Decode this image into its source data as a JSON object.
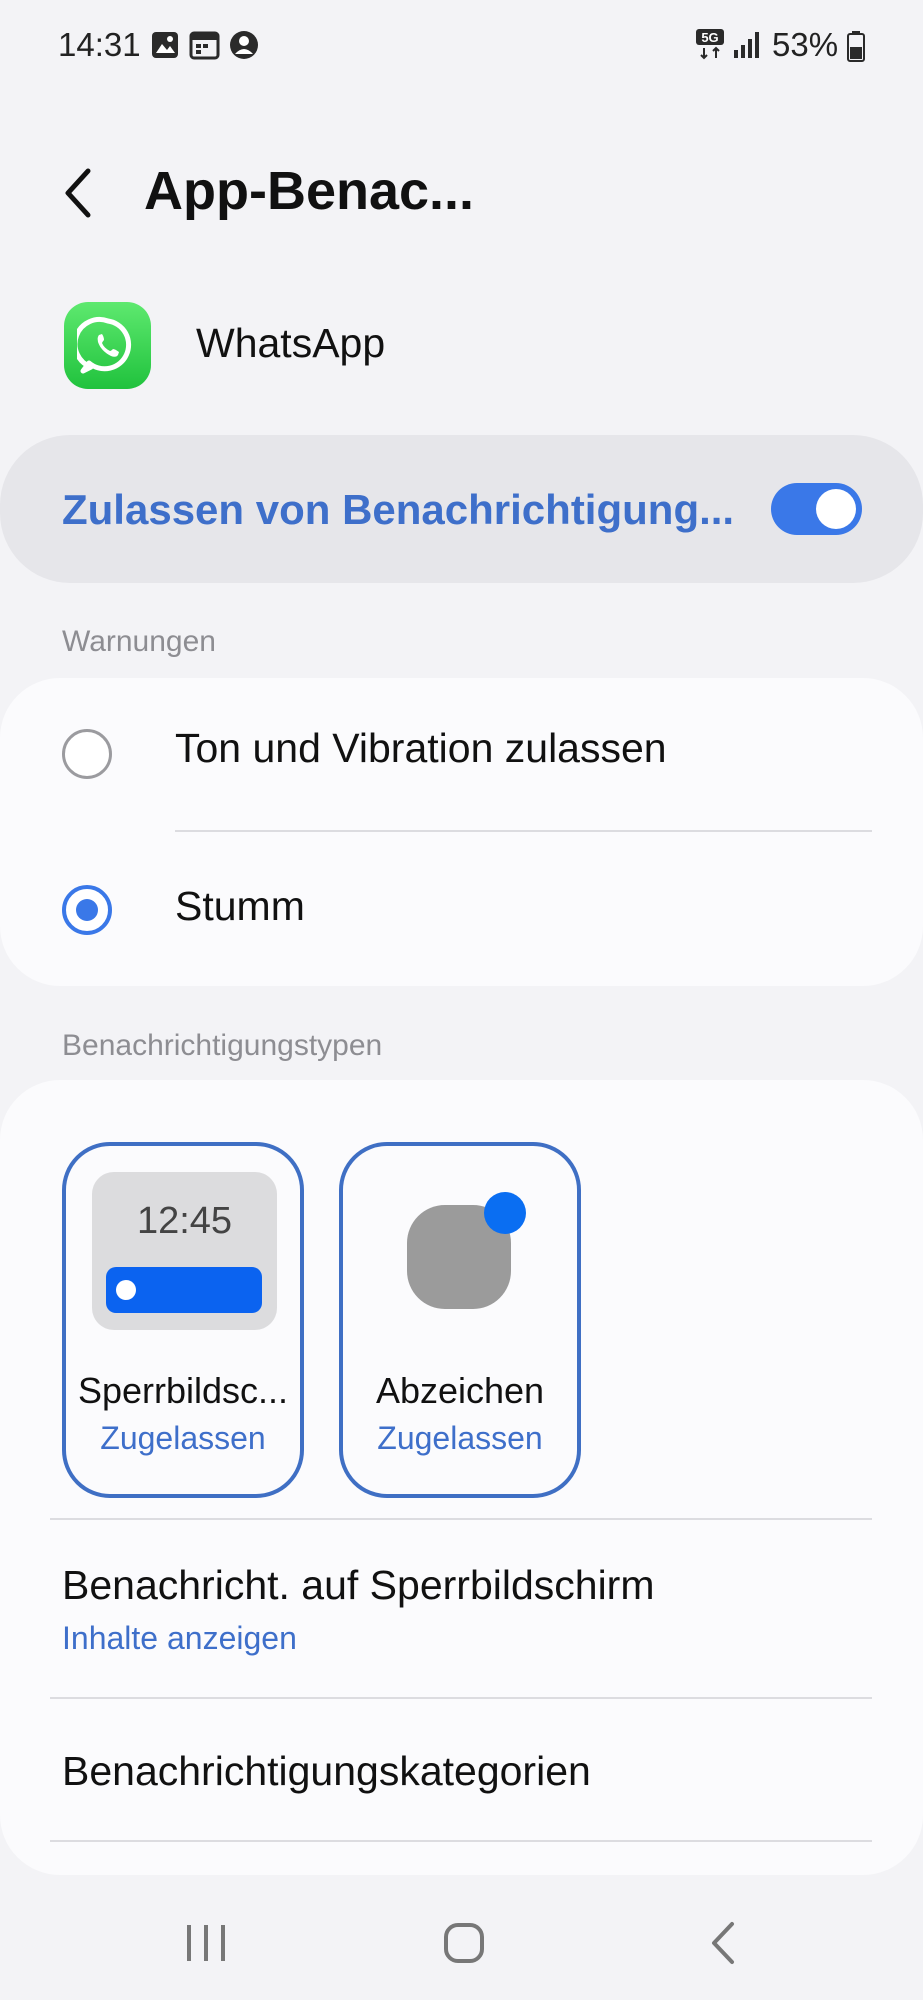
{
  "status_bar": {
    "time": "14:31",
    "icons": [
      "gallery-icon",
      "calendar-icon",
      "account-icon",
      "5g-icon",
      "signal-icon",
      "battery-icon"
    ],
    "network": "5G",
    "battery": "53%"
  },
  "header": {
    "back_icon": "chevron-left-icon",
    "title": "App-Benac..."
  },
  "app": {
    "name": "WhatsApp",
    "icon": "whatsapp-icon",
    "brand_color": "#25D366"
  },
  "allow": {
    "label": "Zulassen von Benachrichtigung...",
    "enabled": true,
    "accent_color": "#3a78e8"
  },
  "warnings": {
    "section_label": "Warnungen",
    "options": [
      {
        "label": "Ton und Vibration zulassen",
        "selected": false
      },
      {
        "label": "Stumm",
        "selected": true
      }
    ]
  },
  "types": {
    "section_label": "Benachrichtigungstypen",
    "tiles": [
      {
        "title": "Sperrbildsc...",
        "status": "Zugelassen",
        "preview_time": "12:45"
      },
      {
        "title": "Abzeichen",
        "status": "Zugelassen"
      }
    ]
  },
  "rows": {
    "lockscreen": {
      "title": "Benachricht. auf Sperrbildschirm",
      "value": "Inhalte anzeigen"
    },
    "categories": {
      "title": "Benachrichtigungskategorien"
    }
  },
  "nav": [
    "recent-apps-icon",
    "home-icon",
    "back-icon"
  ]
}
